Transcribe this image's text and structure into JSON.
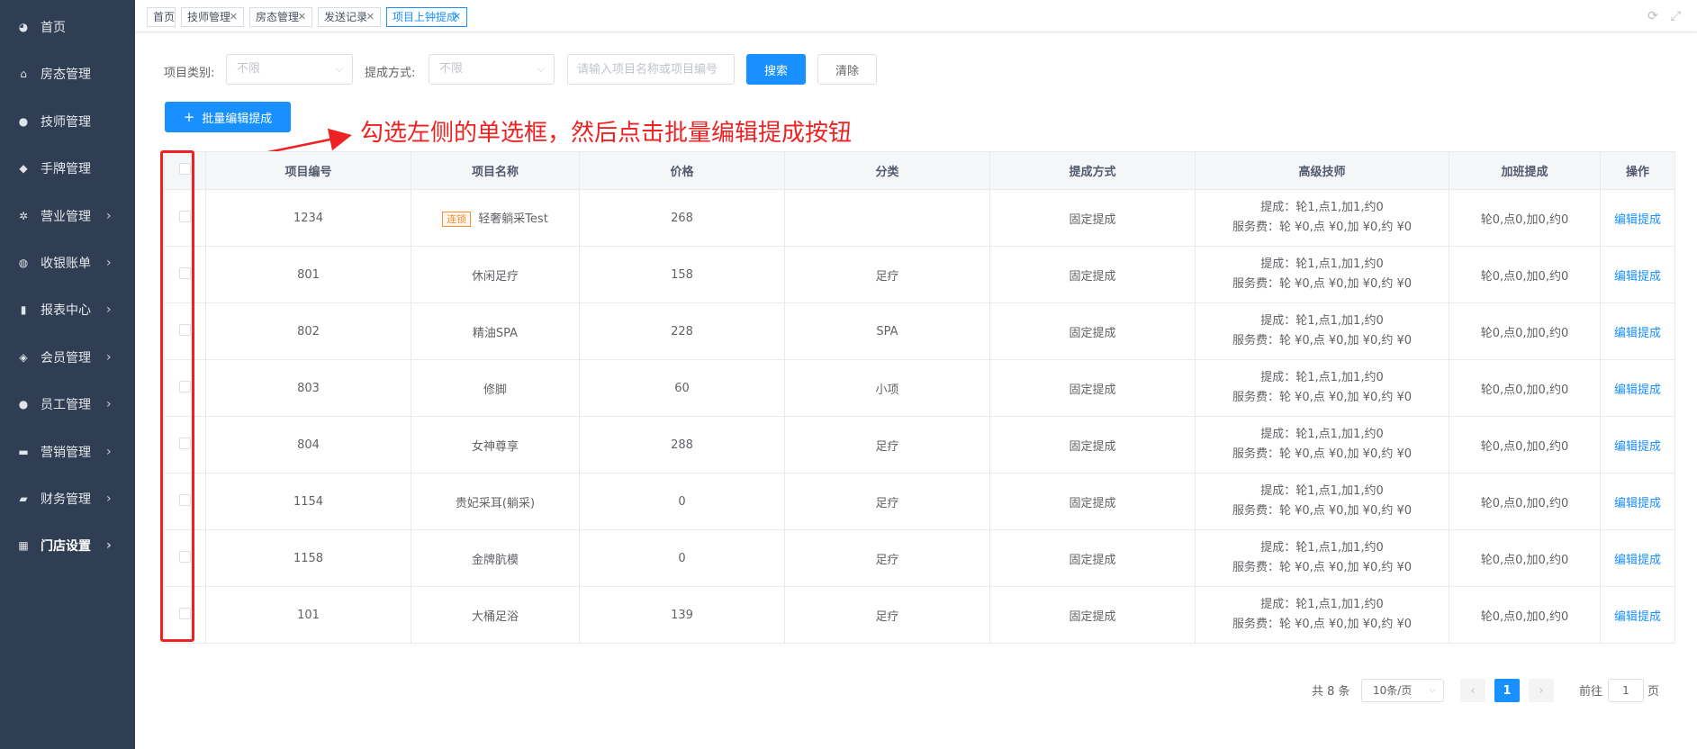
{
  "sidebar": {
    "items": [
      {
        "label": "首页",
        "icon": "dashboard-icon",
        "glyph": "◕",
        "submenu": false
      },
      {
        "label": "房态管理",
        "icon": "home-icon",
        "glyph": "⌂",
        "submenu": false
      },
      {
        "label": "技师管理",
        "icon": "user-icon",
        "glyph": "●",
        "submenu": false
      },
      {
        "label": "手牌管理",
        "icon": "tag-icon",
        "glyph": "◆",
        "submenu": false
      },
      {
        "label": "营业管理",
        "icon": "settings-icon",
        "glyph": "✲",
        "submenu": true
      },
      {
        "label": "收银账单",
        "icon": "money-bag-icon",
        "glyph": "◍",
        "submenu": true
      },
      {
        "label": "报表中心",
        "icon": "bar-chart-icon",
        "glyph": "▮",
        "submenu": true
      },
      {
        "label": "会员管理",
        "icon": "diamond-icon",
        "glyph": "◈",
        "submenu": true
      },
      {
        "label": "员工管理",
        "icon": "user-icon",
        "glyph": "●",
        "submenu": true
      },
      {
        "label": "营销管理",
        "icon": "briefcase-icon",
        "glyph": "▬",
        "submenu": true
      },
      {
        "label": "财务管理",
        "icon": "wallet-icon",
        "glyph": "▰",
        "submenu": true
      },
      {
        "label": "门店设置",
        "icon": "grid-icon",
        "glyph": "▦",
        "submenu": true,
        "active": true
      }
    ]
  },
  "tabs": [
    {
      "label": "首页",
      "closable": false
    },
    {
      "label": "技师管理",
      "closable": true
    },
    {
      "label": "房态管理",
      "closable": true
    },
    {
      "label": "发送记录",
      "closable": true
    },
    {
      "label": "项目上钟提成",
      "closable": true,
      "active": true
    }
  ],
  "filters": {
    "category_label": "项目类别:",
    "category_value": "不限",
    "method_label": "提成方式:",
    "method_value": "不限",
    "search_placeholder": "请输入项目名称或项目编号",
    "search_button": "搜索",
    "clear_button": "清除"
  },
  "batch_button": "批量编辑提成",
  "annotation": "勾选左侧的单选框，然后点击批量编辑提成按钮",
  "table": {
    "headers": [
      "项目编号",
      "项目名称",
      "价格",
      "分类",
      "提成方式",
      "高级技师",
      "加班提成",
      "操作"
    ],
    "rows": [
      {
        "code": "1234",
        "tag": "连锁",
        "name": "轻奢躺采Test",
        "price": "268",
        "category": "",
        "method": "固定提成",
        "commission": "提成：轮1,点1,加1,约0",
        "service_fee": "服务费：轮 ¥0,点 ¥0,加 ¥0,约 ¥0",
        "overtime": "轮0,点0,加0,约0",
        "action": "编辑提成"
      },
      {
        "code": "801",
        "tag": "",
        "name": "休闲足疗",
        "price": "158",
        "category": "足疗",
        "method": "固定提成",
        "commission": "提成：轮1,点1,加1,约0",
        "service_fee": "服务费：轮 ¥0,点 ¥0,加 ¥0,约 ¥0",
        "overtime": "轮0,点0,加0,约0",
        "action": "编辑提成"
      },
      {
        "code": "802",
        "tag": "",
        "name": "精油SPA",
        "price": "228",
        "category": "SPA",
        "method": "固定提成",
        "commission": "提成：轮1,点1,加1,约0",
        "service_fee": "服务费：轮 ¥0,点 ¥0,加 ¥0,约 ¥0",
        "overtime": "轮0,点0,加0,约0",
        "action": "编辑提成"
      },
      {
        "code": "803",
        "tag": "",
        "name": "修脚",
        "price": "60",
        "category": "小项",
        "method": "固定提成",
        "commission": "提成：轮1,点1,加1,约0",
        "service_fee": "服务费：轮 ¥0,点 ¥0,加 ¥0,约 ¥0",
        "overtime": "轮0,点0,加0,约0",
        "action": "编辑提成"
      },
      {
        "code": "804",
        "tag": "",
        "name": "女神尊享",
        "price": "288",
        "category": "足疗",
        "method": "固定提成",
        "commission": "提成：轮1,点1,加1,约0",
        "service_fee": "服务费：轮 ¥0,点 ¥0,加 ¥0,约 ¥0",
        "overtime": "轮0,点0,加0,约0",
        "action": "编辑提成"
      },
      {
        "code": "1154",
        "tag": "",
        "name": "贵妃采耳(躺采)",
        "price": "0",
        "category": "足疗",
        "method": "固定提成",
        "commission": "提成：轮1,点1,加1,约0",
        "service_fee": "服务费：轮 ¥0,点 ¥0,加 ¥0,约 ¥0",
        "overtime": "轮0,点0,加0,约0",
        "action": "编辑提成"
      },
      {
        "code": "1158",
        "tag": "",
        "name": "金牌肮模",
        "price": "0",
        "category": "足疗",
        "method": "固定提成",
        "commission": "提成：轮1,点1,加1,约0",
        "service_fee": "服务费：轮 ¥0,点 ¥0,加 ¥0,约 ¥0",
        "overtime": "轮0,点0,加0,约0",
        "action": "编辑提成"
      },
      {
        "code": "101",
        "tag": "",
        "name": "大桶足浴",
        "price": "139",
        "category": "足疗",
        "method": "固定提成",
        "commission": "提成：轮1,点1,加1,约0",
        "service_fee": "服务费：轮 ¥0,点 ¥0,加 ¥0,约 ¥0",
        "overtime": "轮0,点0,加0,约0",
        "action": "编辑提成"
      }
    ]
  },
  "pagination": {
    "total": "共 8 条",
    "page_size": "10条/页",
    "current_page": "1",
    "goto_label": "前往",
    "goto_value": "1",
    "goto_unit": "页"
  },
  "colors": {
    "sidebar_bg": "#2f3e52",
    "primary": "#1890ff",
    "annotation_red": "#ee2222",
    "tag_orange": "#f29031"
  }
}
